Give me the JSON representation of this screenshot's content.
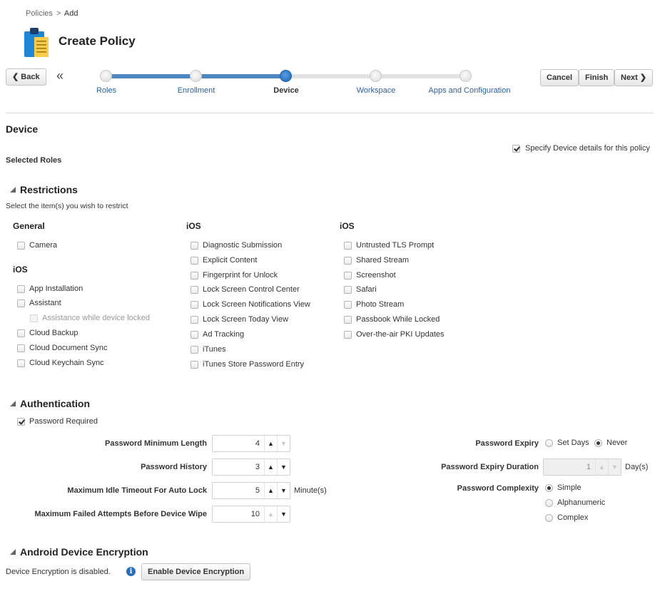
{
  "breadcrumb": {
    "parent": "Policies",
    "separator": ">",
    "current": "Add"
  },
  "page": {
    "title": "Create Policy",
    "icon": "clipboard-icon"
  },
  "nav": {
    "back_label": "Back",
    "collapse_glyph": "«",
    "cancel_label": "Cancel",
    "finish_label": "Finish",
    "next_label": "Next"
  },
  "train": {
    "current_step": 3,
    "steps": [
      {
        "label": "Roles"
      },
      {
        "label": "Enrollment"
      },
      {
        "label": "Device"
      },
      {
        "label": "Workspace"
      },
      {
        "label": "Apps and Configuration"
      }
    ]
  },
  "section": {
    "title": "Device",
    "selected_roles_label": "Selected Roles",
    "specify_label": "Specify Device details for this policy",
    "specify_checked": true
  },
  "restrictions": {
    "title": "Restrictions",
    "instructions": "Select the item(s) you wish to restrict",
    "col1": {
      "general_header": "General",
      "general_items": [
        "Camera"
      ],
      "ios_header": "iOS",
      "ios_items": [
        "App Installation",
        "Assistant",
        "Assistance while device locked",
        "Cloud Backup",
        "Cloud Document Sync",
        "Cloud Keychain Sync"
      ]
    },
    "col2": {
      "header": "iOS",
      "items": [
        "Diagnostic Submission",
        "Explicit Content",
        "Fingerprint for Unlock",
        "Lock Screen Control Center",
        "Lock Screen Notifications View",
        "Lock Screen Today View",
        "Ad Tracking",
        "iTunes",
        "iTunes Store Password Entry"
      ]
    },
    "col3": {
      "header": "iOS",
      "items": [
        "Untrusted TLS Prompt",
        "Shared Stream",
        "Screenshot",
        "Safari",
        "Photo Stream",
        "Passbook While Locked",
        "Over-the-air PKI Updates"
      ]
    }
  },
  "authentication": {
    "title": "Authentication",
    "password_required_label": "Password Required",
    "password_required_checked": true,
    "fields": [
      {
        "label": "Password Minimum Length",
        "value": "4"
      },
      {
        "label": "Password History",
        "value": "3"
      },
      {
        "label": "Maximum Idle Timeout For Auto Lock",
        "value": "5",
        "unit": "Minute(s)"
      },
      {
        "label": "Maximum Failed Attempts Before Device Wipe",
        "value": "10"
      }
    ],
    "expiry": {
      "label": "Password Expiry",
      "options": [
        "Set Days",
        "Never"
      ],
      "selected": "Never"
    },
    "expiry_duration": {
      "label": "Password Expiry Duration",
      "value": "1",
      "unit": "Day(s)"
    },
    "complexity": {
      "label": "Password Complexity",
      "options": [
        "Simple",
        "Alphanumeric",
        "Complex"
      ],
      "selected": "Simple"
    }
  },
  "encryption": {
    "title": "Android Device Encryption",
    "status_text": "Device Encryption is disabled.",
    "enable_label": "Enable Device Encryption"
  },
  "colors": {
    "accent": "#1c63b4",
    "link": "#2a5fa0",
    "info": "#2a6ebb"
  }
}
